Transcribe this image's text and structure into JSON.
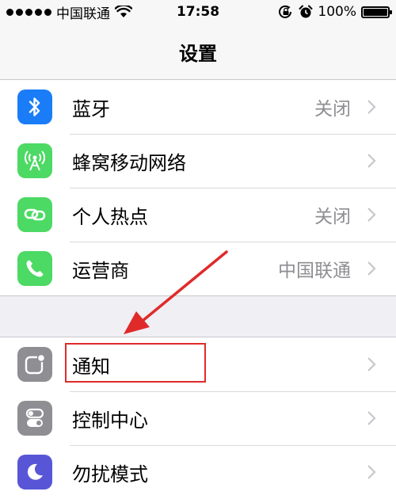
{
  "status_bar": {
    "carrier": "中国联通",
    "time": "17:58",
    "battery": "100%",
    "battery_level": 100,
    "icons": [
      "signal-dots-icon",
      "wifi-icon",
      "rotation-lock-icon",
      "alarm-icon",
      "battery-icon"
    ]
  },
  "nav": {
    "title": "设置"
  },
  "settings_group_1": [
    {
      "label": "蓝牙",
      "value": "关闭",
      "icon": "bluetooth-icon",
      "color": "#1a7df7"
    },
    {
      "label": "蜂窝移动网络",
      "value": "",
      "icon": "cellular-icon",
      "color": "#4cd964"
    },
    {
      "label": "个人热点",
      "value": "关闭",
      "icon": "hotspot-icon",
      "color": "#4cd964"
    },
    {
      "label": "运营商",
      "value": "中国联通",
      "icon": "phone-icon",
      "color": "#4cd964"
    }
  ],
  "settings_group_2": [
    {
      "label": "通知",
      "value": "",
      "icon": "notifications-icon",
      "color": "#8e8e93"
    },
    {
      "label": "控制中心",
      "value": "",
      "icon": "control-center-icon",
      "color": "#8e8e93"
    },
    {
      "label": "勿扰模式",
      "value": "",
      "icon": "moon-icon",
      "color": "#5856d6"
    }
  ],
  "annotation": {
    "highlight_color": "#e02a2a"
  }
}
